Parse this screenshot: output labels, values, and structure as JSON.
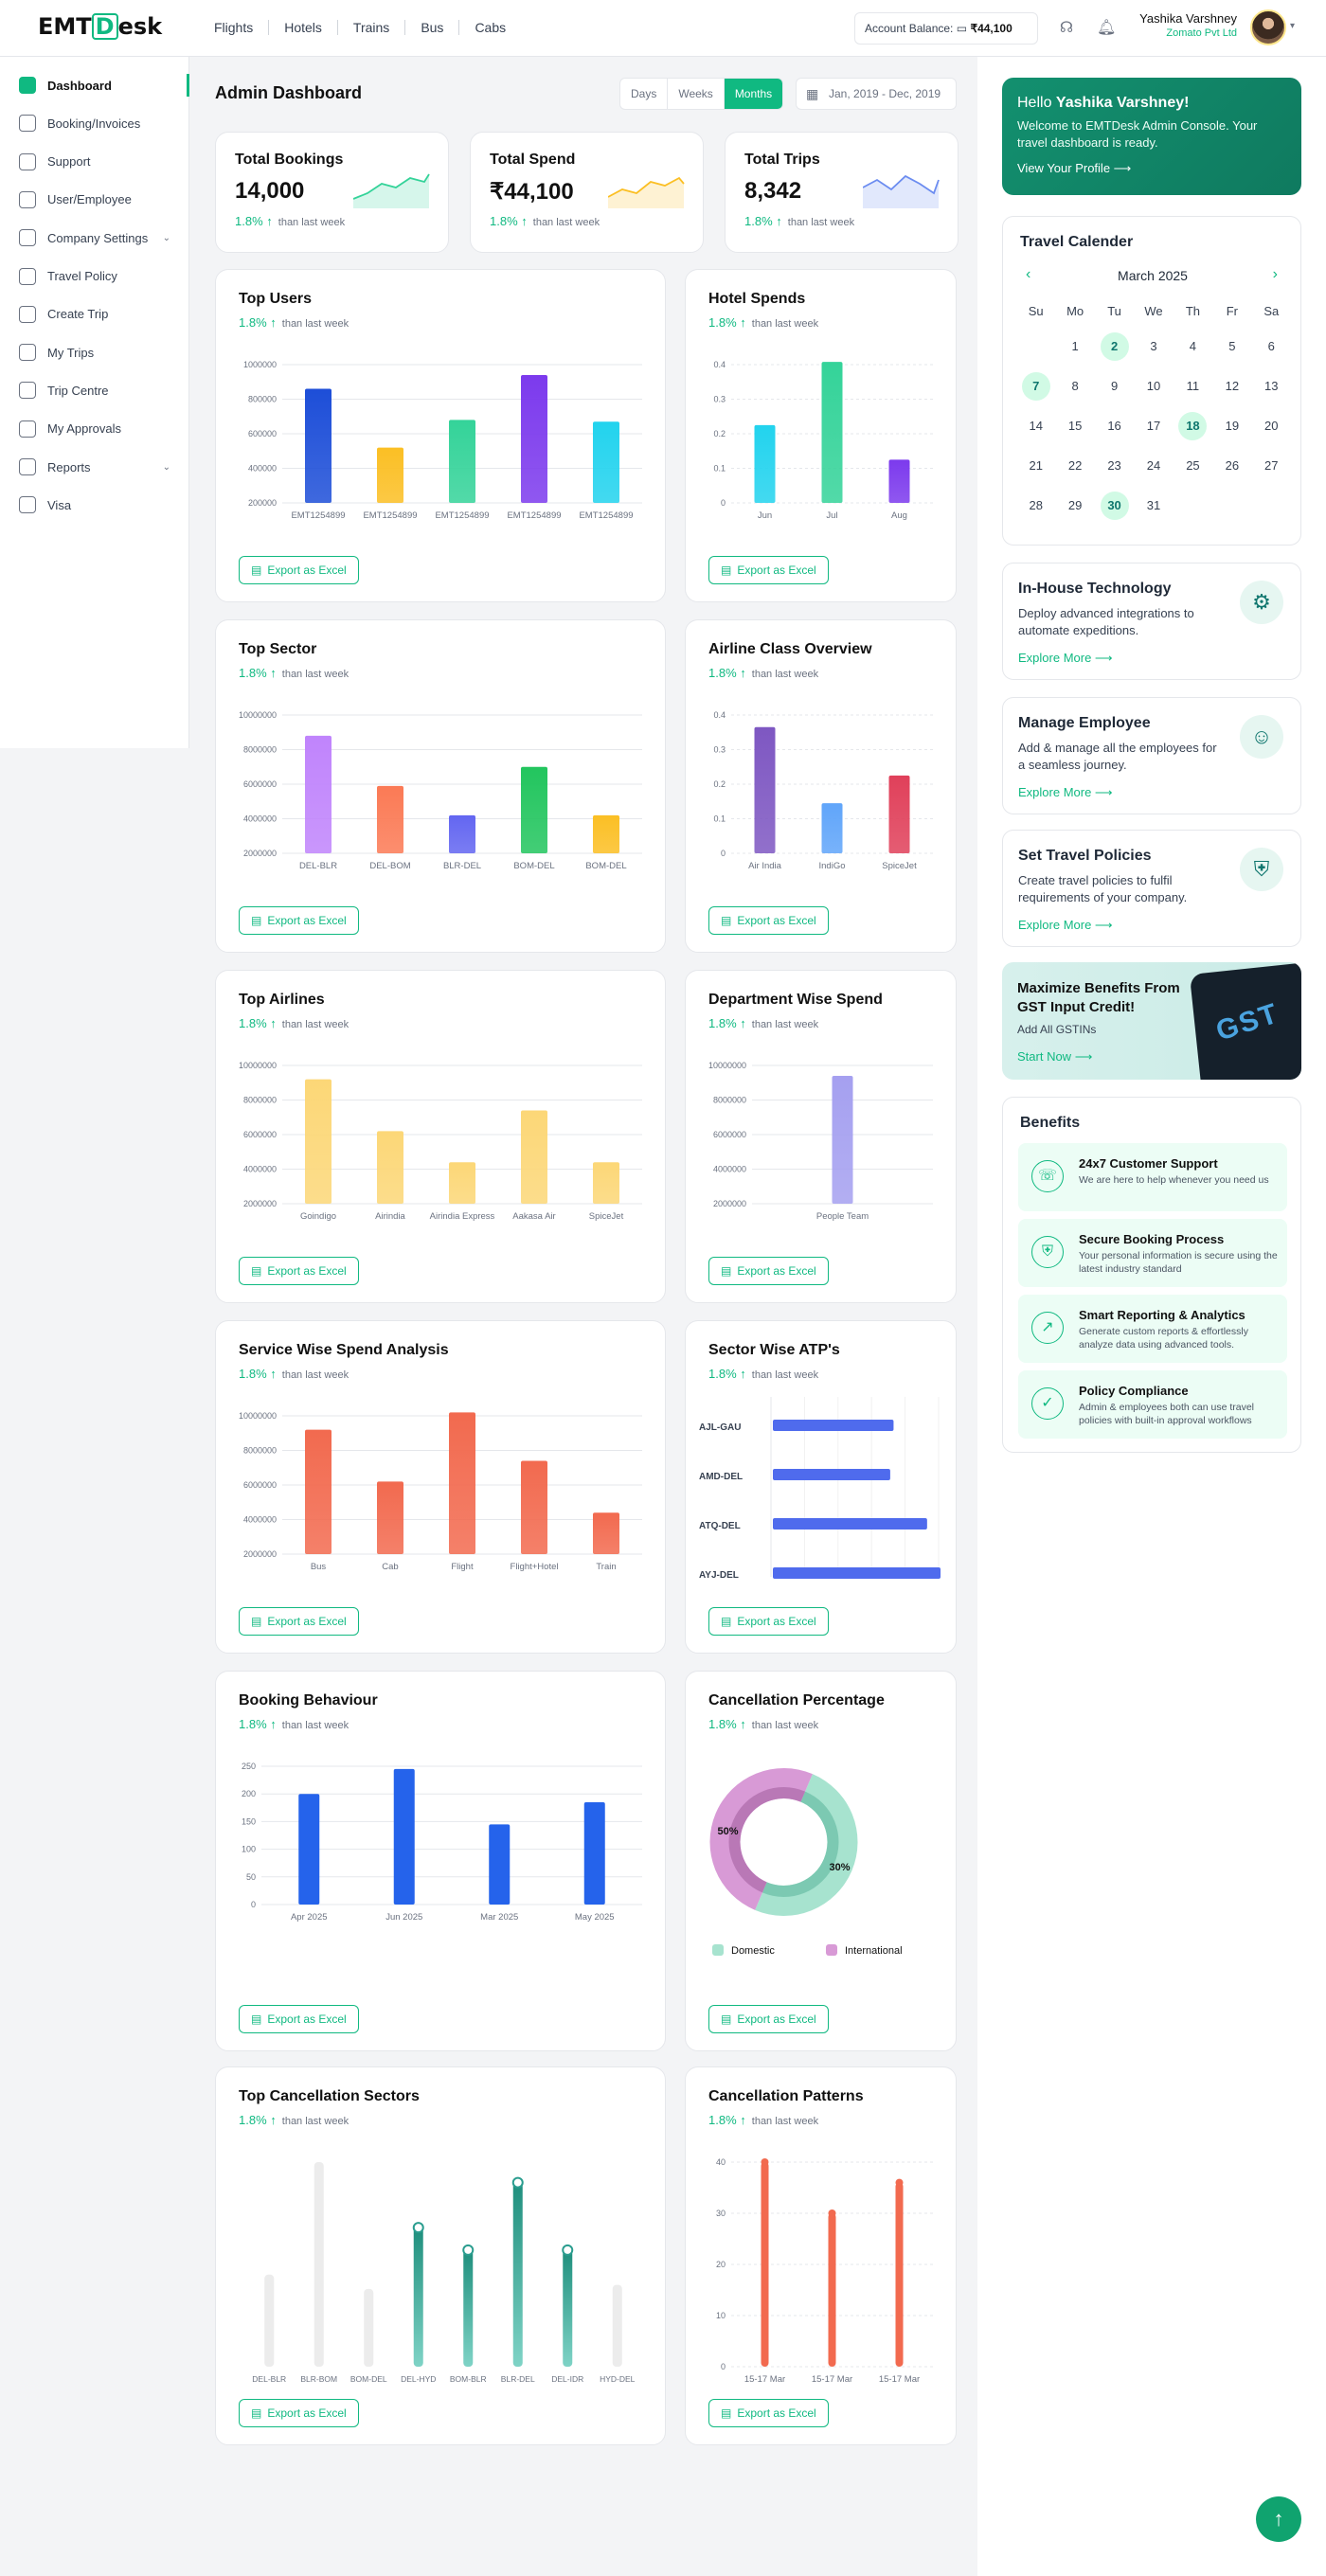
{
  "header": {
    "logo_prefix": "EMT",
    "logo_box": "D",
    "logo_suffix": "esk",
    "nav": [
      "Flights",
      "Hotels",
      "Trains",
      "Bus",
      "Cabs"
    ],
    "balance_label": "Account Balance:",
    "balance_value": "₹44,100",
    "user_name": "Yashika Varshney",
    "user_company": "Zomato Pvt Ltd"
  },
  "sidebar": {
    "items": [
      {
        "label": "Dashboard",
        "icon": "dashboard-icon",
        "active": true
      },
      {
        "label": "Booking/Invoices",
        "icon": "invoice-icon"
      },
      {
        "label": "Support",
        "icon": "headset-icon"
      },
      {
        "label": "User/Employee",
        "icon": "user-icon"
      },
      {
        "label": "Company Settings",
        "icon": "building-icon",
        "expandable": true
      },
      {
        "label": "Travel Policy",
        "icon": "policy-icon"
      },
      {
        "label": "Create Trip",
        "icon": "trip-icon"
      },
      {
        "label": "My Trips",
        "icon": "plane-icon"
      },
      {
        "label": "Trip Centre",
        "icon": "location-icon"
      },
      {
        "label": "My Approvals",
        "icon": "approval-icon"
      },
      {
        "label": "Reports",
        "icon": "report-icon",
        "expandable": true
      },
      {
        "label": "Visa",
        "icon": "visa-icon"
      }
    ]
  },
  "main": {
    "title": "Admin Dashboard",
    "range_tabs": [
      "Days",
      "Weeks",
      "Months"
    ],
    "active_tab": "Months",
    "date_range": "Jan, 2019 - Dec, 2019",
    "export_label": "Export as Excel",
    "delta": "1.8%",
    "delta_note": "than last week"
  },
  "stats": [
    {
      "title": "Total Bookings",
      "value": "14,000"
    },
    {
      "title": "Total Spend",
      "value": "₹44,100"
    },
    {
      "title": "Total Trips",
      "value": "8,342"
    }
  ],
  "chart_data": [
    {
      "id": "top-users",
      "type": "bar",
      "title": "Top Users",
      "categories": [
        "EMT1254899",
        "EMT1254899",
        "EMT1254899",
        "EMT1254899",
        "EMT1254899"
      ],
      "values": [
        860000,
        520000,
        680000,
        940000,
        670000
      ],
      "ylim": [
        200000,
        1000000
      ],
      "yticks": [
        200000,
        400000,
        600000,
        800000,
        1000000
      ],
      "colors": [
        "#1d4ed8",
        "#fbbf24",
        "#34d399",
        "#7c3aed",
        "#22d3ee"
      ]
    },
    {
      "id": "hotel-spends",
      "type": "bar",
      "title": "Hotel Spends",
      "categories": [
        "Jun",
        "Jul",
        "Aug"
      ],
      "values": [
        0.225,
        0.415,
        0.125
      ],
      "ylim": [
        0,
        0.4
      ],
      "yticks": [
        0,
        0.1,
        0.2,
        0.3,
        0.4
      ],
      "colors": [
        "#22d3ee",
        "#34d399",
        "#7c3aed"
      ]
    },
    {
      "id": "top-sector",
      "type": "bar",
      "title": "Top Sector",
      "categories": [
        "DEL-BLR",
        "DEL-BOM",
        "BLR-DEL",
        "BOM-DEL",
        "BOM-DEL"
      ],
      "values": [
        8800000,
        5900000,
        4200000,
        7000000,
        4200000
      ],
      "ylim": [
        2000000,
        10000000
      ],
      "yticks": [
        2000000,
        4000000,
        6000000,
        8000000,
        10000000
      ],
      "colors": [
        "#c084fc",
        "#fb7a55",
        "#6366f1",
        "#22c55e",
        "#fbbf24"
      ]
    },
    {
      "id": "airline-class",
      "type": "bar",
      "title": "Airline Class Overview",
      "categories": [
        "Air India",
        "IndiGo",
        "SpiceJet"
      ],
      "values": [
        0.365,
        0.145,
        0.225
      ],
      "ylim": [
        0,
        0.4
      ],
      "yticks": [
        0,
        0.1,
        0.2,
        0.3,
        0.4
      ],
      "colors": [
        "#7e57c2",
        "#60a5fa",
        "#e0405a"
      ]
    },
    {
      "id": "top-airlines",
      "type": "bar",
      "title": "Top Airlines",
      "categories": [
        "Goindigo",
        "Airindia",
        "Airindia Express",
        "Aakasa Air",
        "SpiceJet"
      ],
      "values": [
        9200000,
        6200000,
        4400000,
        7400000,
        4400000
      ],
      "ylim": [
        2000000,
        10000000
      ],
      "yticks": [
        2000000,
        4000000,
        6000000,
        8000000,
        10000000
      ],
      "colors": [
        "#fcd777",
        "#fcd777",
        "#fcd777",
        "#fcd777",
        "#fcd777"
      ]
    },
    {
      "id": "dept-spend",
      "type": "bar",
      "title": "Department Wise Spend",
      "categories": [
        "People Team"
      ],
      "values": [
        9400000
      ],
      "ylim": [
        2000000,
        10000000
      ],
      "yticks": [
        2000000,
        4000000,
        6000000,
        8000000,
        10000000
      ],
      "colors": [
        "#a5a0f0"
      ]
    },
    {
      "id": "service-spend",
      "type": "bar",
      "title": "Service Wise Spend Analysis",
      "categories": [
        "Bus",
        "Cab",
        "Flight",
        "Flight+Hotel",
        "Train"
      ],
      "values": [
        9200000,
        6200000,
        10200000,
        7400000,
        4400000
      ],
      "ylim": [
        2000000,
        10000000
      ],
      "yticks": [
        2000000,
        4000000,
        6000000,
        8000000,
        10000000
      ],
      "colors": [
        "#f26a4f",
        "#f26a4f",
        "#f26a4f",
        "#f26a4f",
        "#f26a4f"
      ]
    },
    {
      "id": "sector-atp",
      "type": "hbar",
      "title": "Sector Wise ATP's",
      "categories": [
        "AJL-GAU",
        "AMD-DEL",
        "ATQ-DEL",
        "AYJ-DEL"
      ],
      "values": [
        0.72,
        0.7,
        0.92,
        1.0
      ],
      "colors": [
        "#4f6bed",
        "#4f6bed",
        "#4f6bed",
        "#4f6bed"
      ]
    },
    {
      "id": "booking-behaviour",
      "type": "bar",
      "title": "Booking Behaviour",
      "categories": [
        "Apr 2025",
        "Jun 2025",
        "Mar 2025",
        "May 2025"
      ],
      "values": [
        200,
        245,
        145,
        185
      ],
      "ylim": [
        0,
        250
      ],
      "yticks": [
        0,
        50,
        100,
        150,
        200,
        250
      ],
      "colors": [
        "#2563eb",
        "#2563eb",
        "#2563eb",
        "#2563eb"
      ]
    },
    {
      "id": "cancellation-percentage",
      "type": "pie",
      "title": "Cancellation Percentage",
      "slices": [
        {
          "label": "Domestic",
          "value": 50,
          "color": "#a7e3cf"
        },
        {
          "label": "International",
          "value": 50,
          "color": "#d89ad6"
        }
      ],
      "annotations": [
        "50%",
        "30%"
      ]
    },
    {
      "id": "top-cancel-sectors",
      "type": "bar",
      "title": "Top Cancellation Sectors",
      "categories": [
        "DEL-BLR",
        "BLR-BOM",
        "BOM-DEL",
        "DEL-HYD",
        "BOM-BLR",
        "BLR-DEL",
        "DEL-IDR",
        "HYD-DEL"
      ],
      "values": [
        45,
        100,
        38,
        68,
        57,
        90,
        57,
        40
      ],
      "ylim": [
        0,
        100
      ],
      "highlighted": [
        false,
        false,
        false,
        true,
        true,
        true,
        true,
        false
      ]
    },
    {
      "id": "cancel-patterns",
      "type": "bar",
      "title": "Cancellation Patterns",
      "categories": [
        "15-17 Mar",
        "15-17 Mar",
        "15-17 Mar"
      ],
      "values": [
        40,
        30,
        36
      ],
      "ylim": [
        0,
        40
      ],
      "yticks": [
        0,
        10,
        20,
        30,
        40
      ],
      "colors": [
        "#f26a4f",
        "#f26a4f",
        "#f26a4f"
      ]
    }
  ],
  "welcome": {
    "greeting": "Hello",
    "name": "Yashika Varshney!",
    "message": "Welcome to EMTDesk Admin Console. Your travel dashboard is ready.",
    "link": "View Your Profile"
  },
  "calendar": {
    "title": "Travel Calender",
    "month": "March 2025",
    "dows": [
      "Su",
      "Mo",
      "Tu",
      "We",
      "Th",
      "Fr",
      "Sa"
    ],
    "lead_blanks": 1,
    "days": 31,
    "highlighted": [
      2,
      7,
      18,
      30
    ]
  },
  "features": [
    {
      "title": "In-House Technology",
      "desc": "Deploy advanced integrations to automate expeditions.",
      "link": "Explore More",
      "icon": "chip-icon"
    },
    {
      "title": "Manage Employee",
      "desc": "Add & manage all the employees for a seamless journey.",
      "link": "Explore More",
      "icon": "employee-icon"
    },
    {
      "title": "Set Travel Policies",
      "desc": "Create travel policies to fulfil requirements of your company.",
      "link": "Explore More",
      "icon": "policy-shield-icon"
    }
  ],
  "gst": {
    "title": "Maximize Benefits From GST Input Credit!",
    "sub": "Add All GSTINs",
    "link": "Start Now",
    "key_text": "GST"
  },
  "benefits": {
    "title": "Benefits",
    "items": [
      {
        "title": "24x7 Customer Support",
        "desc": "We are here to help whenever you need us",
        "icon": "support-agent-icon"
      },
      {
        "title": "Secure Booking Process",
        "desc": "Your personal information is secure using the latest industry standard",
        "icon": "shield-check-icon"
      },
      {
        "title": "Smart Reporting & Analytics",
        "desc": "Generate custom reports & effortlessly analyze data using advanced tools.",
        "icon": "analytics-icon"
      },
      {
        "title": "Policy Compliance",
        "desc": "Admin & employees both can use travel policies with built-in approval workflows",
        "icon": "compliance-icon"
      }
    ]
  }
}
